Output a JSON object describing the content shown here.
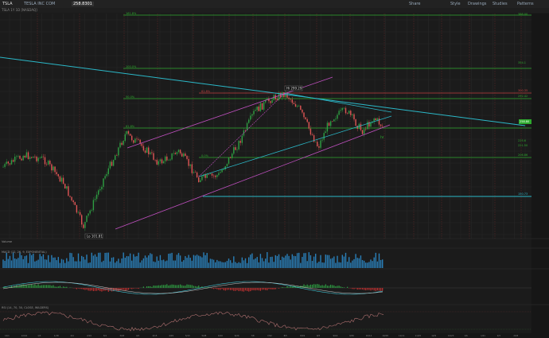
{
  "toolbar": {
    "symbol": "TSLA",
    "company": "TESLA INC COM",
    "price": "258.8301",
    "buttons": [
      {
        "label": "Share"
      },
      {
        "label": "Style"
      },
      {
        "label": "Drawings"
      },
      {
        "label": "Studies"
      },
      {
        "label": "Patterns"
      }
    ]
  },
  "study_title": "TSLA 1Y 1D [NASDAQ]",
  "fib_labels": {
    "r1": "161.8%",
    "r2": "100.0%",
    "r3": "61.8%",
    "r4": "50.0%",
    "r5": "61.8%",
    "r6": "0.0%"
  },
  "price_labels": {
    "hi": "388.00",
    "p354": "354.1",
    "p300": "300.35",
    "p292": "292.42",
    "current": "258.80",
    "p225": "225.6",
    "p221": "221.50",
    "p206": "206.86",
    "p150": "150.73"
  },
  "annotations": {
    "high": "Hi 299.29",
    "low": "Lo 101.81",
    "wave_label": "iv"
  },
  "panels": {
    "volume": "Volume",
    "macd": "MACD (12, 26, 9, EXPONENTIAL)",
    "rsi": "RSI (14, 70, 30, CLOSE, WILDERS)"
  },
  "x_ticks": [
    "12/1",
    "12/9",
    "12/16",
    "12/23",
    "1/3",
    "1/10",
    "1/18",
    "1/28",
    "2/4",
    "2/11",
    "2/19",
    "2/26",
    "3/4",
    "3/11",
    "3/18",
    "3/25",
    "4/1",
    "4/8",
    "4/15",
    "4/22",
    "4/29",
    "5/6",
    "5/13",
    "5/20",
    "5/28",
    "6/3",
    "6/10",
    "6/17",
    "6/24",
    "7/1",
    "7/8",
    "7/15",
    "7/22",
    "7/29",
    "8/5",
    "8/12",
    "8/19",
    "8/26",
    "9/3",
    "9/9",
    "9/16",
    "9/23",
    "9/30",
    "10/7",
    "10/14",
    "10/21",
    "10/28",
    "11/4",
    "11/11",
    "11/18",
    "11/25",
    "12/2",
    "12/9",
    "12/16",
    "12/23",
    "12/30",
    "1/6",
    "1/13",
    "1/21",
    "1/27",
    "2/3",
    "2/10",
    "2/18",
    "2/24"
  ],
  "colors": {
    "bull": "#2ea043",
    "bear": "#e05555",
    "fib": "#2eaa2e",
    "cyan": "#2bb8c8",
    "magenta": "#c050c0"
  }
}
